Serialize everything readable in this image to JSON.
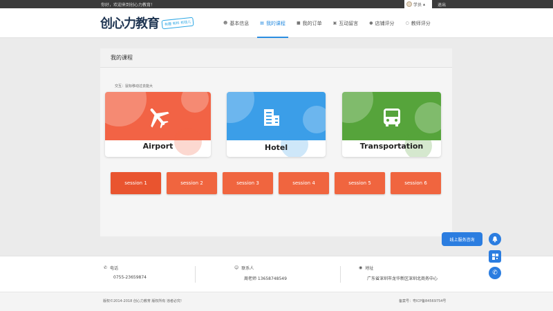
{
  "topbar": {
    "welcome": "你好，欢迎来到创心力教育！",
    "user_label": "学员",
    "logout": "退出"
  },
  "header": {
    "logo": {
      "brand": "创心力教育",
      "slogan": "有趣 有料 有钱儿"
    },
    "nav": [
      {
        "label": "基本信息",
        "icon": "person-icon"
      },
      {
        "label": "我的课程",
        "icon": "chart-icon",
        "active": true
      },
      {
        "label": "我的订单",
        "icon": "order-icon"
      },
      {
        "label": "互动留言",
        "icon": "message-icon"
      },
      {
        "label": "店铺评分",
        "icon": "store-icon"
      },
      {
        "label": "教师评分",
        "icon": "teacher-icon"
      }
    ]
  },
  "main": {
    "title": "我的课程",
    "hint": "交互：鼠标移动过去能大",
    "cards": [
      {
        "label": "Airport",
        "icon": "airplane-icon",
        "color": "#f26345"
      },
      {
        "label": "Hotel",
        "icon": "hotel-icon",
        "color": "#3b9ee8"
      },
      {
        "label": "Transportation",
        "icon": "bus-icon",
        "color": "#56a43b"
      }
    ],
    "sessions": [
      "session 1",
      "session 2",
      "session 3",
      "session 4",
      "session 5",
      "session 6"
    ]
  },
  "footer": {
    "phone": {
      "title": "电话",
      "value": "0755-23659874"
    },
    "contact": {
      "title": "联系人",
      "value": "周老师  13658748549"
    },
    "address": {
      "title": "地址",
      "value": "广东省深圳市龙华新区深圳北商务中心"
    },
    "copyright": "版权©2014-2018 创心力教育 版权所有 违者必究!",
    "icp": "备案号：粤ICP备84569754号"
  },
  "service": {
    "label": "线上服务咨询"
  },
  "colors": {
    "accent": "#2b7de0",
    "session": "#f0653f"
  }
}
